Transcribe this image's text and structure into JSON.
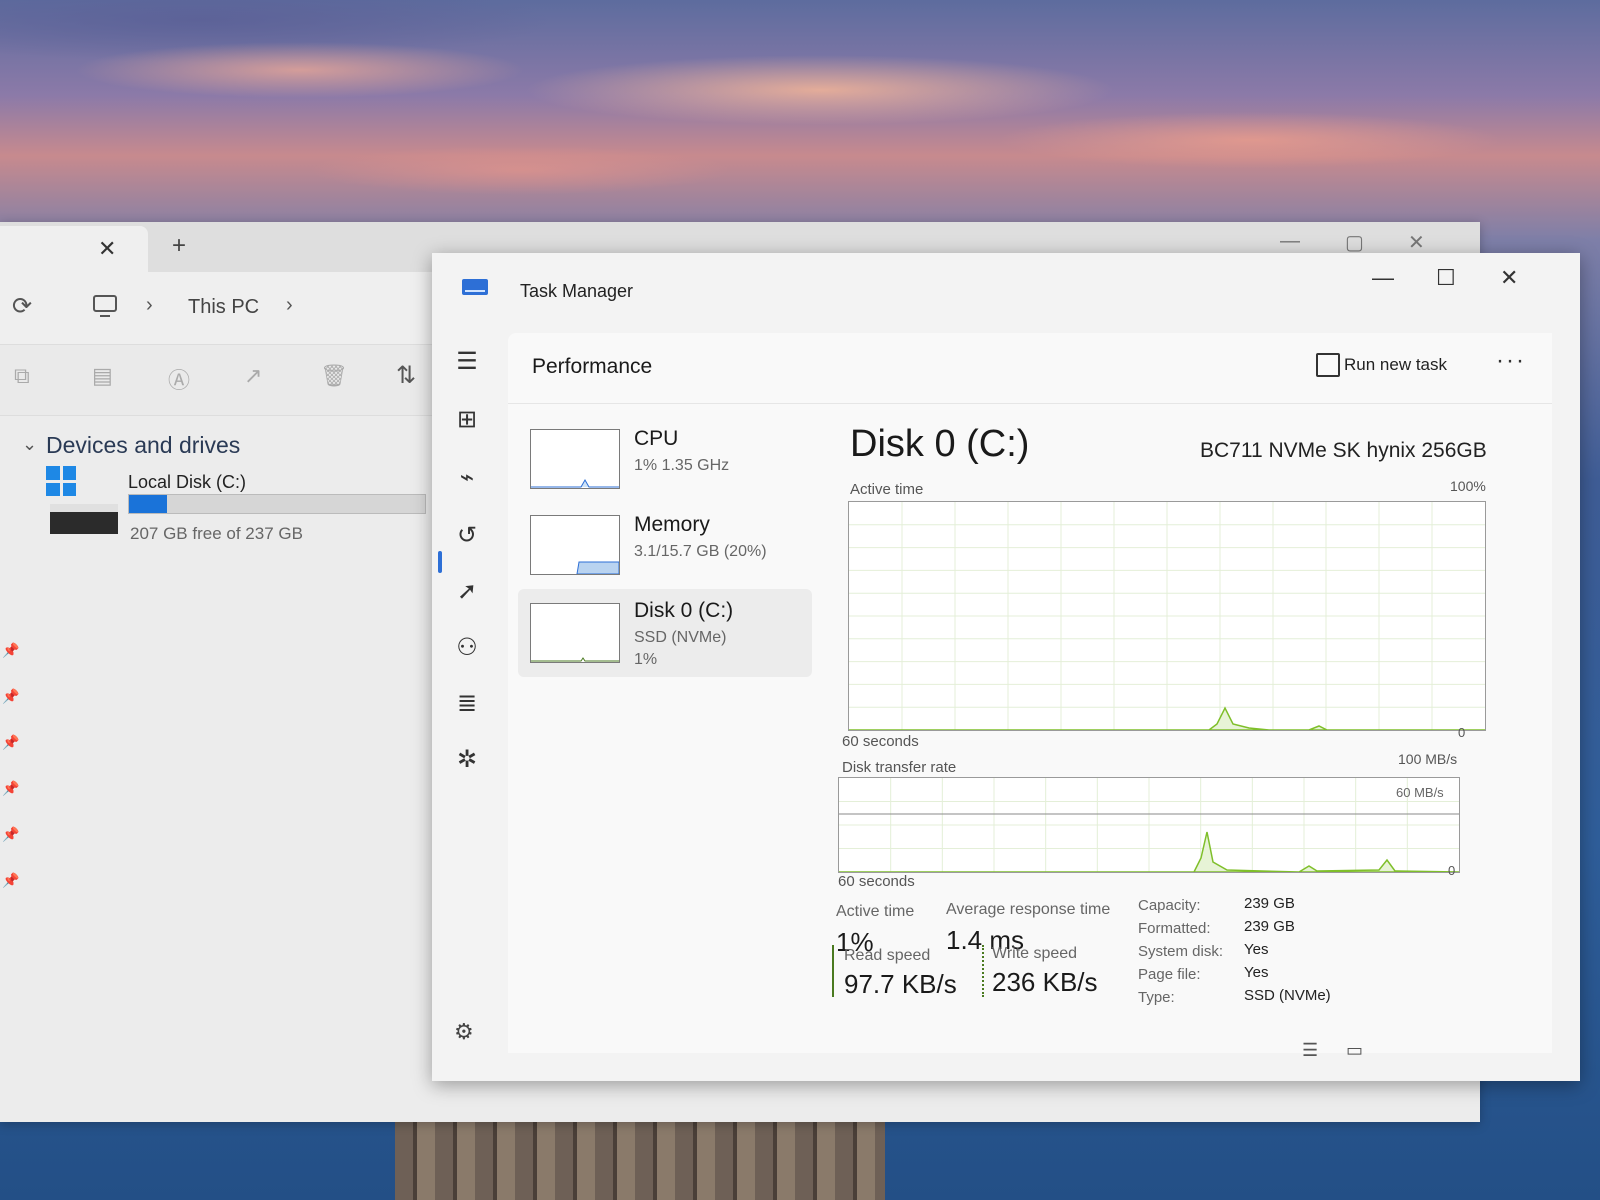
{
  "explorer": {
    "tab_close": "✕",
    "new_tab": "+",
    "window_controls": {
      "minimize": "—",
      "maximize": "▢",
      "close": "✕"
    },
    "breadcrumb": {
      "location": "This PC"
    },
    "group_title": "Devices and drives",
    "drive": {
      "name": "Local Disk (C:)",
      "free_text": "207 GB free of 237 GB",
      "used_fraction": 0.127
    }
  },
  "task_manager": {
    "title": "Task Manager",
    "window_controls": {
      "minimize": "—",
      "maximize": "☐",
      "close": "✕"
    },
    "page_title": "Performance",
    "run_new_task": "Run new task",
    "more": "···",
    "sidebar": [
      {
        "name": "CPU",
        "sub1": "1% 1.35 GHz",
        "sub2": ""
      },
      {
        "name": "Memory",
        "sub1": "3.1/15.7 GB (20%)",
        "sub2": ""
      },
      {
        "name": "Disk 0 (C:)",
        "sub1": "SSD (NVMe)",
        "sub2": "1%"
      }
    ],
    "detail": {
      "title": "Disk 0 (C:)",
      "model": "BC711 NVMe SK hynix 256GB",
      "active_time_label": "Active time",
      "active_time_max": "100%",
      "active_time_xlabel": "60 seconds",
      "active_time_min": "0",
      "transfer_label": "Disk transfer rate",
      "transfer_max": "100 MB/s",
      "transfer_mid": "60 MB/s",
      "transfer_xlabel": "60 seconds",
      "transfer_min": "0",
      "stats": {
        "active_time_label": "Active time",
        "active_time": "1%",
        "avg_response_label": "Average response time",
        "avg_response": "1.4 ms",
        "read_label": "Read speed",
        "read": "97.7 KB/s",
        "write_label": "Write speed",
        "write": "236 KB/s"
      },
      "properties": [
        {
          "key": "Capacity:",
          "value": "239 GB"
        },
        {
          "key": "Formatted:",
          "value": "239 GB"
        },
        {
          "key": "System disk:",
          "value": "Yes"
        },
        {
          "key": "Page file:",
          "value": "Yes"
        },
        {
          "key": "Type:",
          "value": "SSD (NVMe)"
        }
      ]
    }
  },
  "colors": {
    "accent": "#2d6fd6",
    "disk_graph": "#7fbf2a",
    "drive_fill": "#1a73d9"
  }
}
